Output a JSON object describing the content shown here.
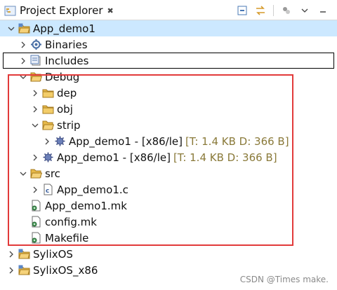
{
  "view": {
    "tab_title": "Project Explorer",
    "tab_close": "✖"
  },
  "tree": [
    {
      "label": "App_demo1",
      "depth": 0,
      "arrow": "down",
      "icon": "project-folder-icon",
      "selected": true
    },
    {
      "label": "Binaries",
      "depth": 1,
      "arrow": "right",
      "icon": "binaries-icon"
    },
    {
      "label": "Includes",
      "depth": 1,
      "arrow": "right",
      "icon": "includes-icon",
      "boxed": true
    },
    {
      "label": "Debug",
      "depth": 1,
      "arrow": "down",
      "icon": "folder-open-icon"
    },
    {
      "label": "dep",
      "depth": 2,
      "arrow": "right",
      "icon": "folder-icon"
    },
    {
      "label": "obj",
      "depth": 2,
      "arrow": "right",
      "icon": "folder-icon"
    },
    {
      "label": "strip",
      "depth": 2,
      "arrow": "down",
      "icon": "folder-open-icon"
    },
    {
      "label": "App_demo1 - [x86/le]",
      "meta": "[T: 1.4 KB  D: 366 B]",
      "depth": 3,
      "arrow": "right",
      "icon": "executable-icon"
    },
    {
      "label": "App_demo1 - [x86/le]",
      "meta": "[T: 1.4 KB  D: 366 B]",
      "depth": 2,
      "arrow": "right",
      "icon": "executable-icon"
    },
    {
      "label": "src",
      "depth": 1,
      "arrow": "down",
      "icon": "folder-open-icon"
    },
    {
      "label": "App_demo1.c",
      "depth": 2,
      "arrow": "right",
      "icon": "c-file-icon"
    },
    {
      "label": "App_demo1.mk",
      "depth": 1,
      "arrow": "none",
      "icon": "makefile-icon"
    },
    {
      "label": "config.mk",
      "depth": 1,
      "arrow": "none",
      "icon": "makefile-icon"
    },
    {
      "label": "Makefile",
      "depth": 1,
      "arrow": "none",
      "icon": "makefile-icon"
    },
    {
      "label": "SylixOS",
      "depth": 0,
      "arrow": "right",
      "icon": "project-folder-icon"
    },
    {
      "label": "SylixOS_x86",
      "depth": 0,
      "arrow": "right",
      "icon": "project-folder-icon"
    }
  ],
  "watermark": "CSDN @Times make.",
  "colors": {
    "selection": "#cce8ff",
    "highlight_box": "#e23a3a",
    "meta_text": "#8a7a3a"
  }
}
